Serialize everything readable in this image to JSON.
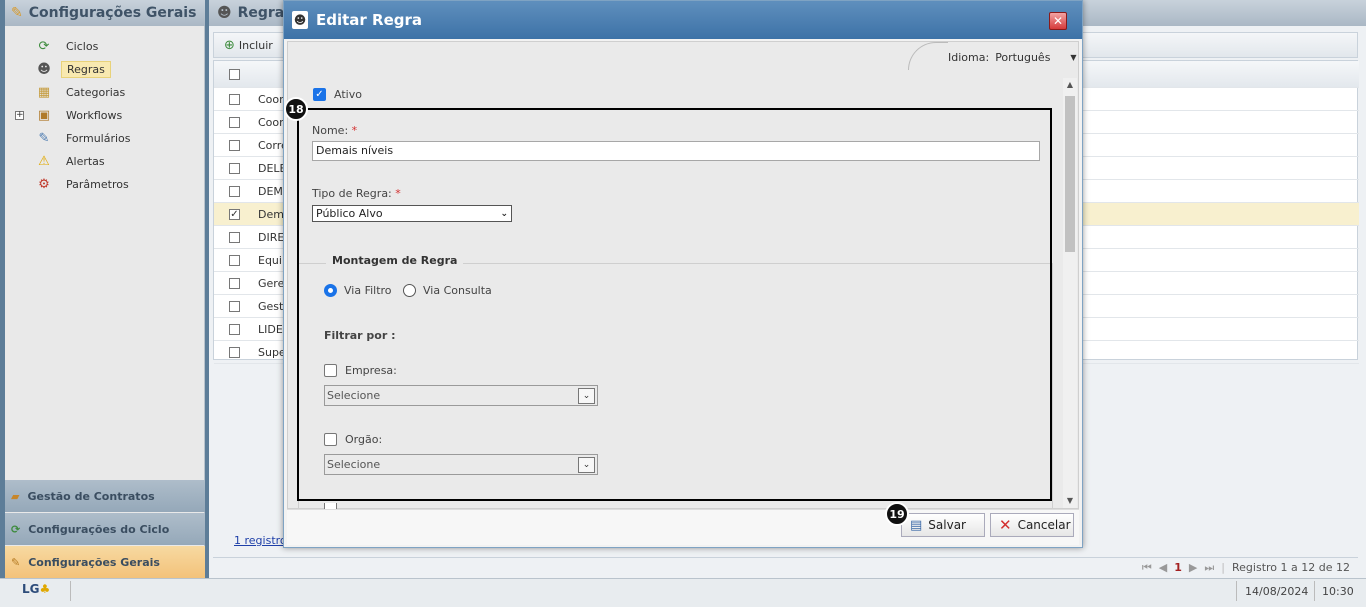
{
  "sidebar": {
    "title": "Configurações Gerais",
    "items": [
      {
        "label": "Ciclos",
        "icon": "cycle-icon"
      },
      {
        "label": "Regras",
        "icon": "user-icon",
        "selected": true
      },
      {
        "label": "Categorias",
        "icon": "category-icon"
      },
      {
        "label": "Workflows",
        "icon": "workflow-icon"
      },
      {
        "label": "Formulários",
        "icon": "form-icon"
      },
      {
        "label": "Alertas",
        "icon": "warning-icon"
      },
      {
        "label": "Parâmetros",
        "icon": "gear-icon"
      }
    ],
    "accordion": [
      {
        "label": "Gestão de Contratos"
      },
      {
        "label": "Configurações do Ciclo"
      },
      {
        "label": "Configurações Gerais"
      }
    ]
  },
  "main": {
    "title": "Regras",
    "toolbar": {
      "add_label": "Incluir"
    },
    "rows": [
      "Coor",
      "Coor",
      "Corre",
      "DELE",
      "DEMA",
      "Dema",
      "DIRE",
      "Equip",
      "Geren",
      "Gesto",
      "LIDEI",
      "Supe"
    ],
    "selected_row_index": 5,
    "registros_link": "1 registro(",
    "pager": {
      "current": "1",
      "info": "Registro 1 a 12 de 12"
    }
  },
  "status": {
    "logo": "LG",
    "date": "14/08/2024",
    "time": "10:30"
  },
  "dialog": {
    "title": "Editar Regra",
    "idioma_label": "Idioma:",
    "idioma_value": "Português",
    "ativo_label": "Ativo",
    "ativo_checked": true,
    "nome_label": "Nome:",
    "nome_value": "Demais níveis",
    "tipo_label": "Tipo de Regra:",
    "tipo_value": "Público Alvo",
    "montagem_legend": "Montagem de Regra",
    "via_filtro_label": "Via Filtro",
    "via_consulta_label": "Via Consulta",
    "filtrar_label": "Filtrar por :",
    "empresa_label": "Empresa:",
    "empresa_placeholder": "Selecione",
    "orgao_label": "Orgão:",
    "orgao_placeholder": "Selecione",
    "required_mark": "*",
    "badge_a": "18",
    "badge_b": "19",
    "save_label": "Salvar",
    "cancel_label": "Cancelar"
  },
  "colors": {
    "title_bar": "#3d72a7",
    "accent": "#1a73e8",
    "selected_nav": "#f8e9b0"
  }
}
